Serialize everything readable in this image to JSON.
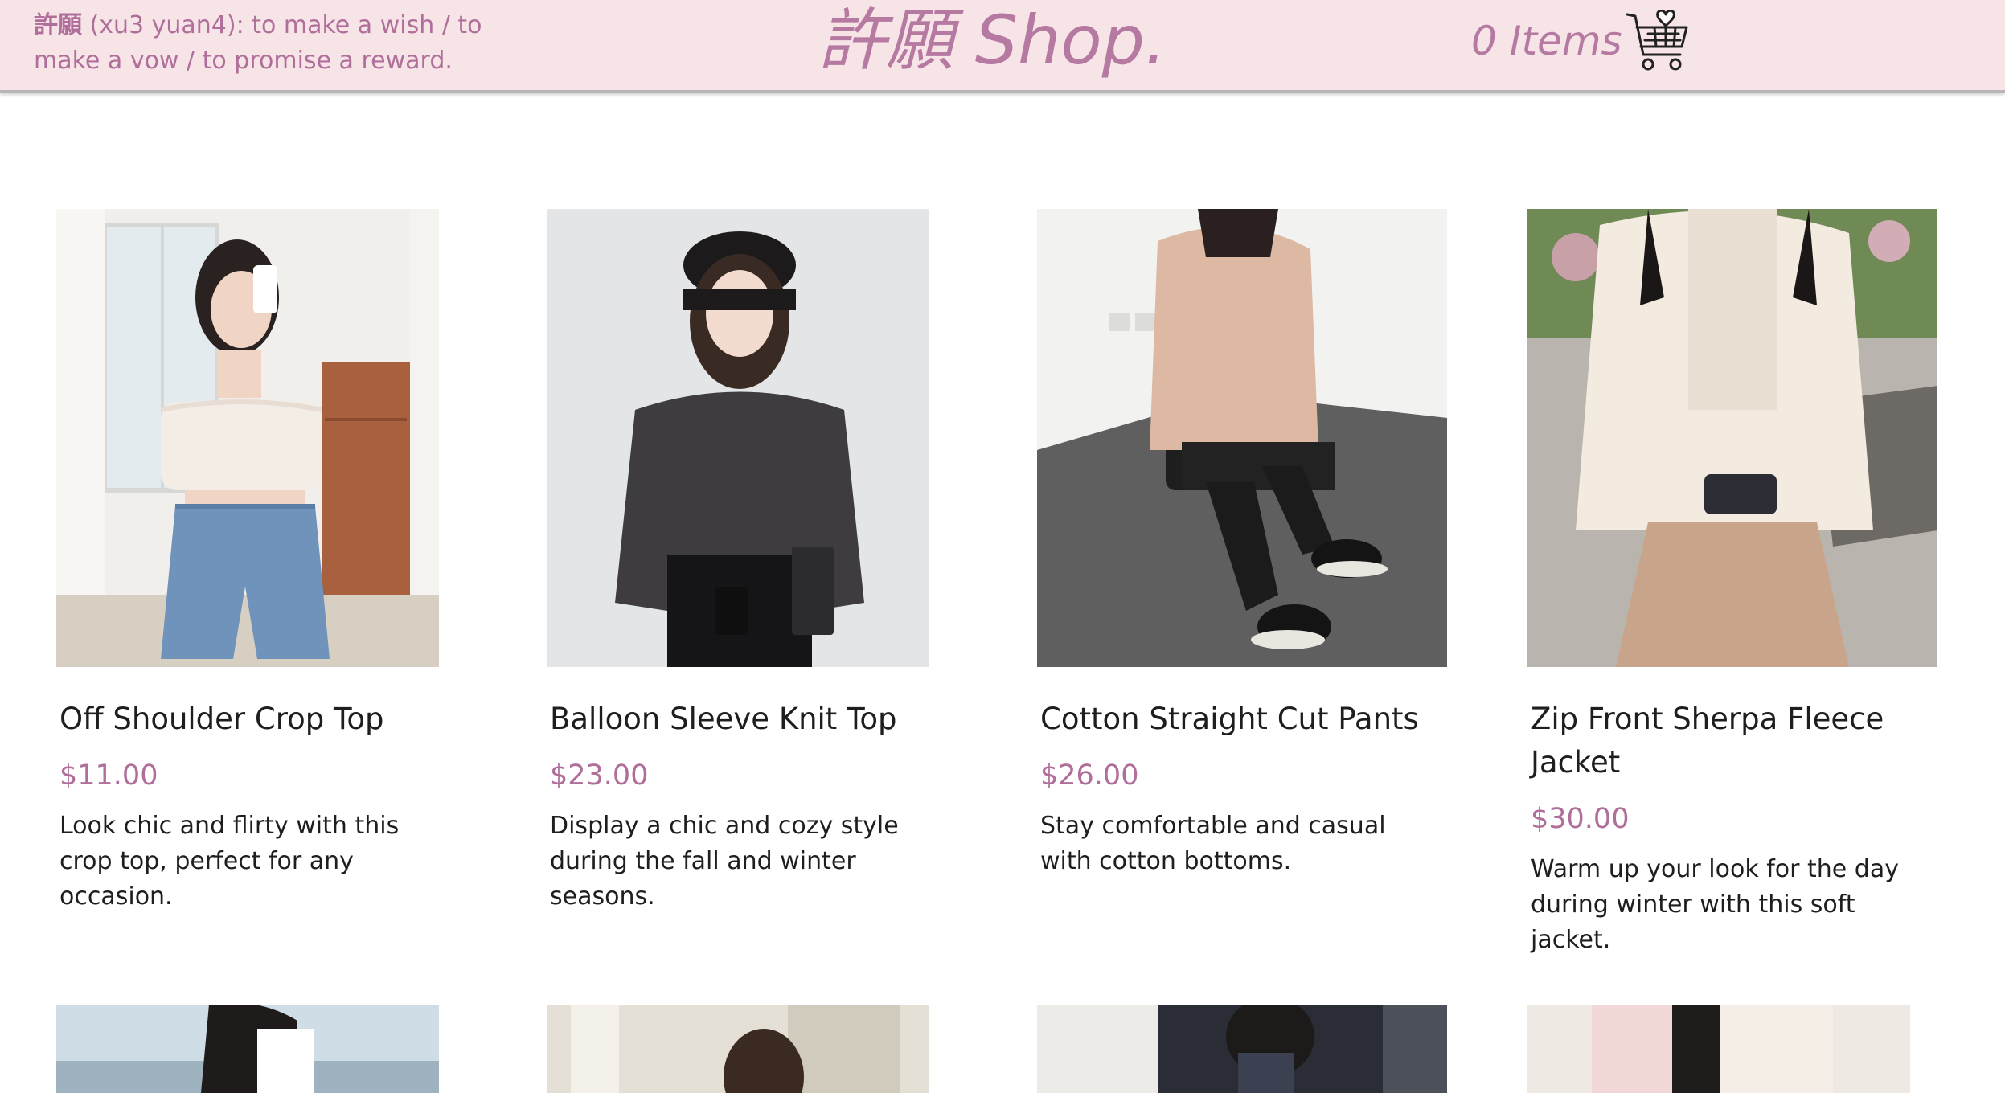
{
  "header": {
    "definition_term": "許願",
    "definition_text": " (xu3 yuan4): to make a wish / to make a vow / to promise a reward.",
    "brand": "許願 Shop.",
    "cart_count_label": "0 Items",
    "cart_icon": "shopping-cart-heart-icon"
  },
  "colors": {
    "header_bg": "#f7e4e7",
    "accent": "#b579a2",
    "price": "#b06f9b",
    "text": "#1e1e1e"
  },
  "products": [
    {
      "title": "Off Shoulder Crop Top",
      "price": "$11.00",
      "description": "Look chic and flirty with this crop top, perfect for any occasion."
    },
    {
      "title": "Balloon Sleeve Knit Top",
      "price": "$23.00",
      "description": "Display a chic and cozy style during the fall and winter seasons."
    },
    {
      "title": "Cotton Straight Cut Pants",
      "price": "$26.00",
      "description": "Stay comfortable and casual with cotton bottoms."
    },
    {
      "title": "Zip Front Sherpa Fleece Jacket",
      "price": "$30.00",
      "description": "Warm up your look for the day during winter with this soft jacket."
    }
  ]
}
